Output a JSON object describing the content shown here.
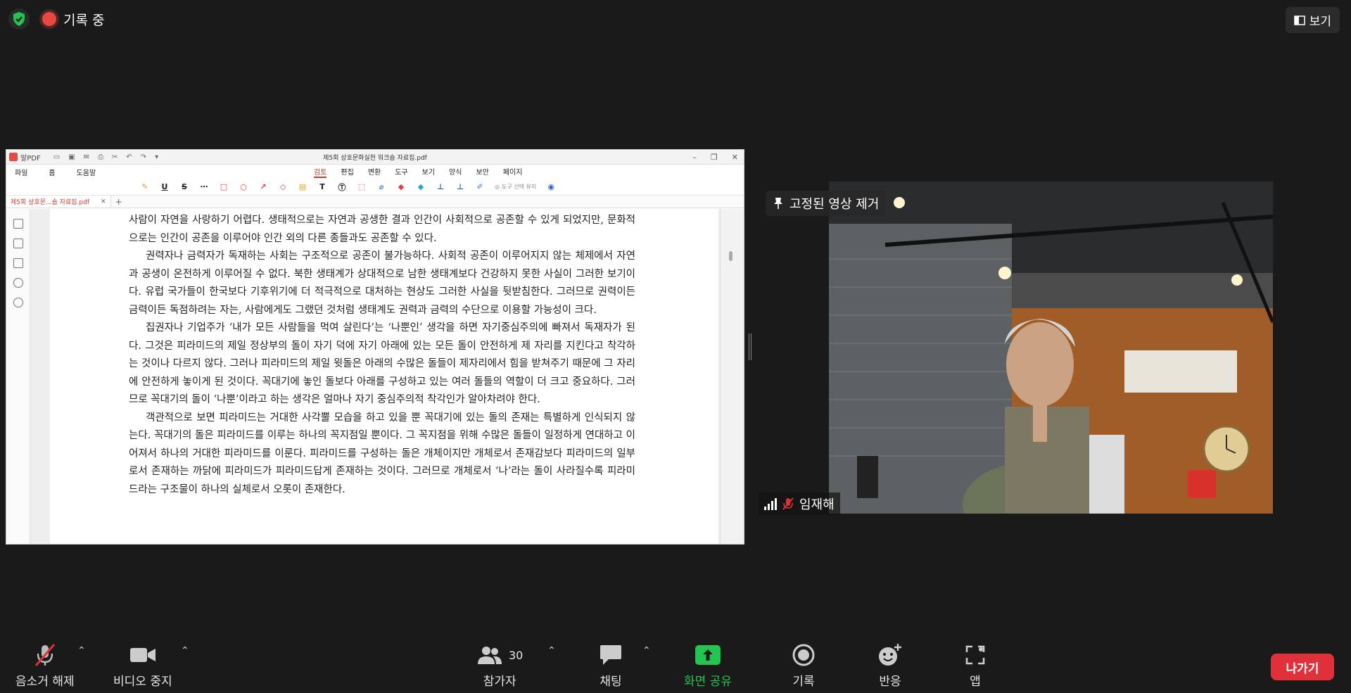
{
  "top": {
    "recording_label": "기록 중",
    "view_label": "보기"
  },
  "pdf": {
    "app_name": "알PDF",
    "file_title": "제5회 상호문화실천 워크숍 자료집.pdf",
    "menu_left": [
      "파일",
      "홈",
      "도움말"
    ],
    "menu_center": [
      "검토",
      "편집",
      "변환",
      "도구",
      "보기",
      "양식",
      "보안",
      "페이지"
    ],
    "tool_hint": "도구 선택 유지",
    "tab_label": "제5회 상호문...숍 자료집.pdf",
    "paragraphs": [
      {
        "indent": false,
        "text": "사람이 자연을 사랑하기 어렵다. 생태적으로는 자연과 공생한 결과 인간이 사회적으로 공존할 수 있게 되었지만, 문화적으로는 인간이 공존을 이루어야 인간 외의 다른 종들과도 공존할 수 있다."
      },
      {
        "indent": true,
        "text": "권력자나 금력자가 독재하는 사회는 구조적으로 공존이 불가능하다. 사회적 공존이 이루어지지 않는 체제에서 자연과 공생이 온전하게 이루어질 수 없다. 북한 생태계가 상대적으로 남한 생태계보다 건강하지 못한 사실이 그러한 보기이다. 유럽 국가들이 한국보다 기후위기에 더 적극적으로 대처하는 현상도 그러한 사실을 뒷받침한다. 그러므로 권력이든 금력이든 독점하려는 자는, 사람에게도 그랬던 것처럼 생태계도 권력과 금력의 수단으로 이용할 가능성이 크다."
      },
      {
        "indent": true,
        "text": "집권자나 기업주가 ‘내가 모든 사람들을 먹여 살린다’는 ‘나뿐인’ 생각을 하면 자기중심주의에 빠져서 독재자가 된다. 그것은 피라미드의 제일 정상부의 돌이 자기 덕에 자기 아래에 있는 모든 돌이 안전하게 제 자리를 지킨다고 착각하는 것이나 다르지 않다. 그러나 피라미드의 제일 윗돌은 아래의 수많은 돌들이 제자리에서 힘을 받쳐주기 때문에 그 자리에 안전하게 놓이게 된 것이다. 꼭대기에 놓인 돌보다 아래를 구성하고 있는 여러 돌들의 역할이 더 크고 중요하다. 그러므로 꼭대기의 돌이 ‘나뿐’이라고 하는 생각은 얼마나 자기 중심주의적 착각인가 알아차려야 한다."
      },
      {
        "indent": true,
        "text": "객관적으로 보면 피라미드는 거대한 사각뿔 모습을 하고 있을 뿐 꼭대기에 있는 돌의 존재는 특별하게 인식되지 않는다. 꼭대기의 돌은 피라미드를 이루는 하나의 꼭지점일 뿐이다. 그 꼭지점을 위해 수많은 돌들이 일정하게 연대하고 이어져서 하나의 거대한 피라미드를 이룬다. 피라미드를 구성하는 돌은 개체이지만 개체로서 존재감보다 피라미드의 일부로서 존재하는 까닭에 피라미드가 피라미드답게 존재하는 것이다. 그러므로 개체로서 ‘나’라는 돌이 사라질수록 피라미드라는 구조물이 하나의 실체로서 오롯이 존재한다."
      }
    ]
  },
  "video": {
    "pin_label": "고정된 영상 제거",
    "participant_name": "임재해"
  },
  "toolbar": {
    "unmute": "음소거 해제",
    "stop_video": "비디오 중지",
    "participants": "참가자",
    "participant_count": "30",
    "chat": "채팅",
    "share": "화면 공유",
    "record": "기록",
    "reactions": "반응",
    "apps": "앱",
    "leave": "나가기"
  },
  "colors": {
    "share_green": "#23c552",
    "leave_red": "#e0303a",
    "accent_red": "#d63a2e"
  }
}
